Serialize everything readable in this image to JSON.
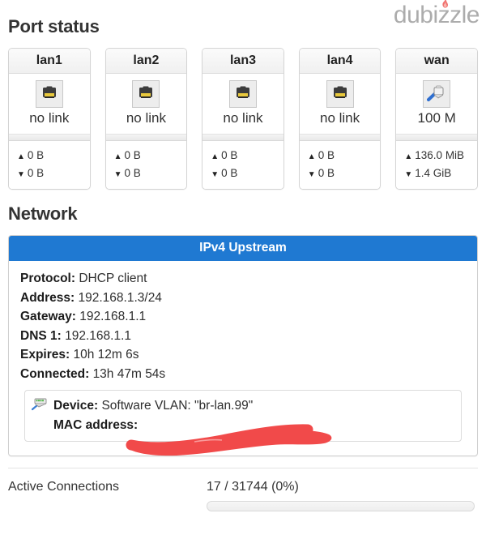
{
  "watermark": {
    "text": "dubizzle",
    "icon": "flame-icon"
  },
  "sections": {
    "port_status_title": "Port status",
    "network_title": "Network"
  },
  "ports": [
    {
      "name": "lan1",
      "icon": "ethernet-port-icon",
      "link_status": "no link",
      "tx": "0 B",
      "rx": "0 B",
      "up_arrow": "▲",
      "down_arrow": "▼"
    },
    {
      "name": "lan2",
      "icon": "ethernet-port-icon",
      "link_status": "no link",
      "tx": "0 B",
      "rx": "0 B",
      "up_arrow": "▲",
      "down_arrow": "▼"
    },
    {
      "name": "lan3",
      "icon": "ethernet-port-icon",
      "link_status": "no link",
      "tx": "0 B",
      "rx": "0 B",
      "up_arrow": "▲",
      "down_arrow": "▼"
    },
    {
      "name": "lan4",
      "icon": "ethernet-port-icon",
      "link_status": "no link",
      "tx": "0 B",
      "rx": "0 B",
      "up_arrow": "▲",
      "down_arrow": "▼"
    },
    {
      "name": "wan",
      "icon": "ethernet-connected-icon",
      "link_status": "100 M",
      "tx": "136.0 MiB",
      "rx": "1.4 GiB",
      "up_arrow": "▲",
      "down_arrow": "▼"
    }
  ],
  "network": {
    "header": "IPv4 Upstream",
    "header_color": "#1f79d2",
    "rows": [
      {
        "label": "Protocol:",
        "value": "DHCP client"
      },
      {
        "label": "Address:",
        "value": "192.168.1.3/24"
      },
      {
        "label": "Gateway:",
        "value": "192.168.1.1"
      },
      {
        "label": "DNS 1:",
        "value": "192.168.1.1"
      },
      {
        "label": "Expires:",
        "value": "10h 12m 6s"
      },
      {
        "label": "Connected:",
        "value": "13h 47m 54s"
      }
    ],
    "device": {
      "icon": "network-switch-icon",
      "device_label": "Device:",
      "device_value": "Software VLAN: \"br-lan.99\"",
      "mac_label": "MAC address:",
      "mac_value": "",
      "redaction_color": "#f14a4a"
    }
  },
  "active_connections": {
    "label": "Active Connections",
    "value": "17 / 31744 (0%)",
    "percent": 0
  }
}
